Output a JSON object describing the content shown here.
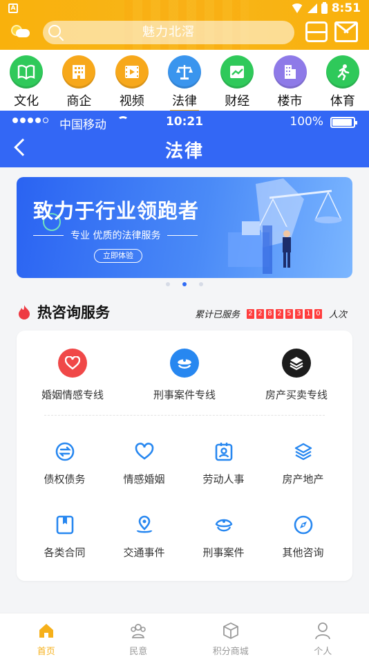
{
  "android_status": {
    "time": "8:51"
  },
  "header": {
    "search_placeholder": "魅力北滘"
  },
  "categories": [
    {
      "label": "文化",
      "color": "#2fc95a",
      "icon": "book-icon"
    },
    {
      "label": "商企",
      "color": "#f7a81b",
      "icon": "building-icon"
    },
    {
      "label": "视频",
      "color": "#f7a81b",
      "icon": "film-icon"
    },
    {
      "label": "法律",
      "color": "#3a95ee",
      "icon": "scale-icon",
      "active": true
    },
    {
      "label": "财经",
      "color": "#2fc95a",
      "icon": "chart-icon"
    },
    {
      "label": "楼市",
      "color": "#8e7ae8",
      "icon": "tower-icon"
    },
    {
      "label": "体育",
      "color": "#2fc95a",
      "icon": "runner-icon"
    }
  ],
  "inner_status": {
    "carrier": "中国移动",
    "time": "10:21",
    "battery": "100%"
  },
  "nav": {
    "title": "法律"
  },
  "banner": {
    "title": "致力于行业领跑者",
    "subtitle": "专业 优质的法律服务",
    "button": "立即体验"
  },
  "hot": {
    "title": "热咨询服务",
    "served_prefix": "累计已服务",
    "digits": [
      "2",
      "2",
      "8",
      "2",
      "5",
      "3",
      "1",
      "0"
    ],
    "served_suffix": "人次"
  },
  "hotlines": [
    {
      "label": "婚姻情感专线",
      "color": "#f04848",
      "icon": "heart-icon"
    },
    {
      "label": "刑事案件专线",
      "color": "#2787f0",
      "icon": "police-cap-icon"
    },
    {
      "label": "房产买卖专线",
      "color": "#1c1c1c",
      "icon": "layers-icon"
    }
  ],
  "services_row1": [
    {
      "label": "债权债务",
      "icon": "exchange-icon"
    },
    {
      "label": "情感婚姻",
      "icon": "heart-outline-icon"
    },
    {
      "label": "劳动人事",
      "icon": "badge-icon"
    },
    {
      "label": "房产地产",
      "icon": "layers-outline-icon"
    }
  ],
  "services_row2": [
    {
      "label": "各类合同",
      "icon": "contract-icon"
    },
    {
      "label": "交通事件",
      "icon": "location-pin-icon"
    },
    {
      "label": "刑事案件",
      "icon": "police-cap-outline-icon"
    },
    {
      "label": "其他咨询",
      "icon": "compass-icon"
    }
  ],
  "tabs": [
    {
      "label": "首页",
      "icon": "home-icon",
      "active": true
    },
    {
      "label": "民意",
      "icon": "people-icon"
    },
    {
      "label": "积分商城",
      "icon": "cube-icon"
    },
    {
      "label": "个人",
      "icon": "user-icon"
    }
  ],
  "colors": {
    "accent": "#f9b10c",
    "blue": "#3367f5",
    "service_icon": "#2787f0"
  }
}
